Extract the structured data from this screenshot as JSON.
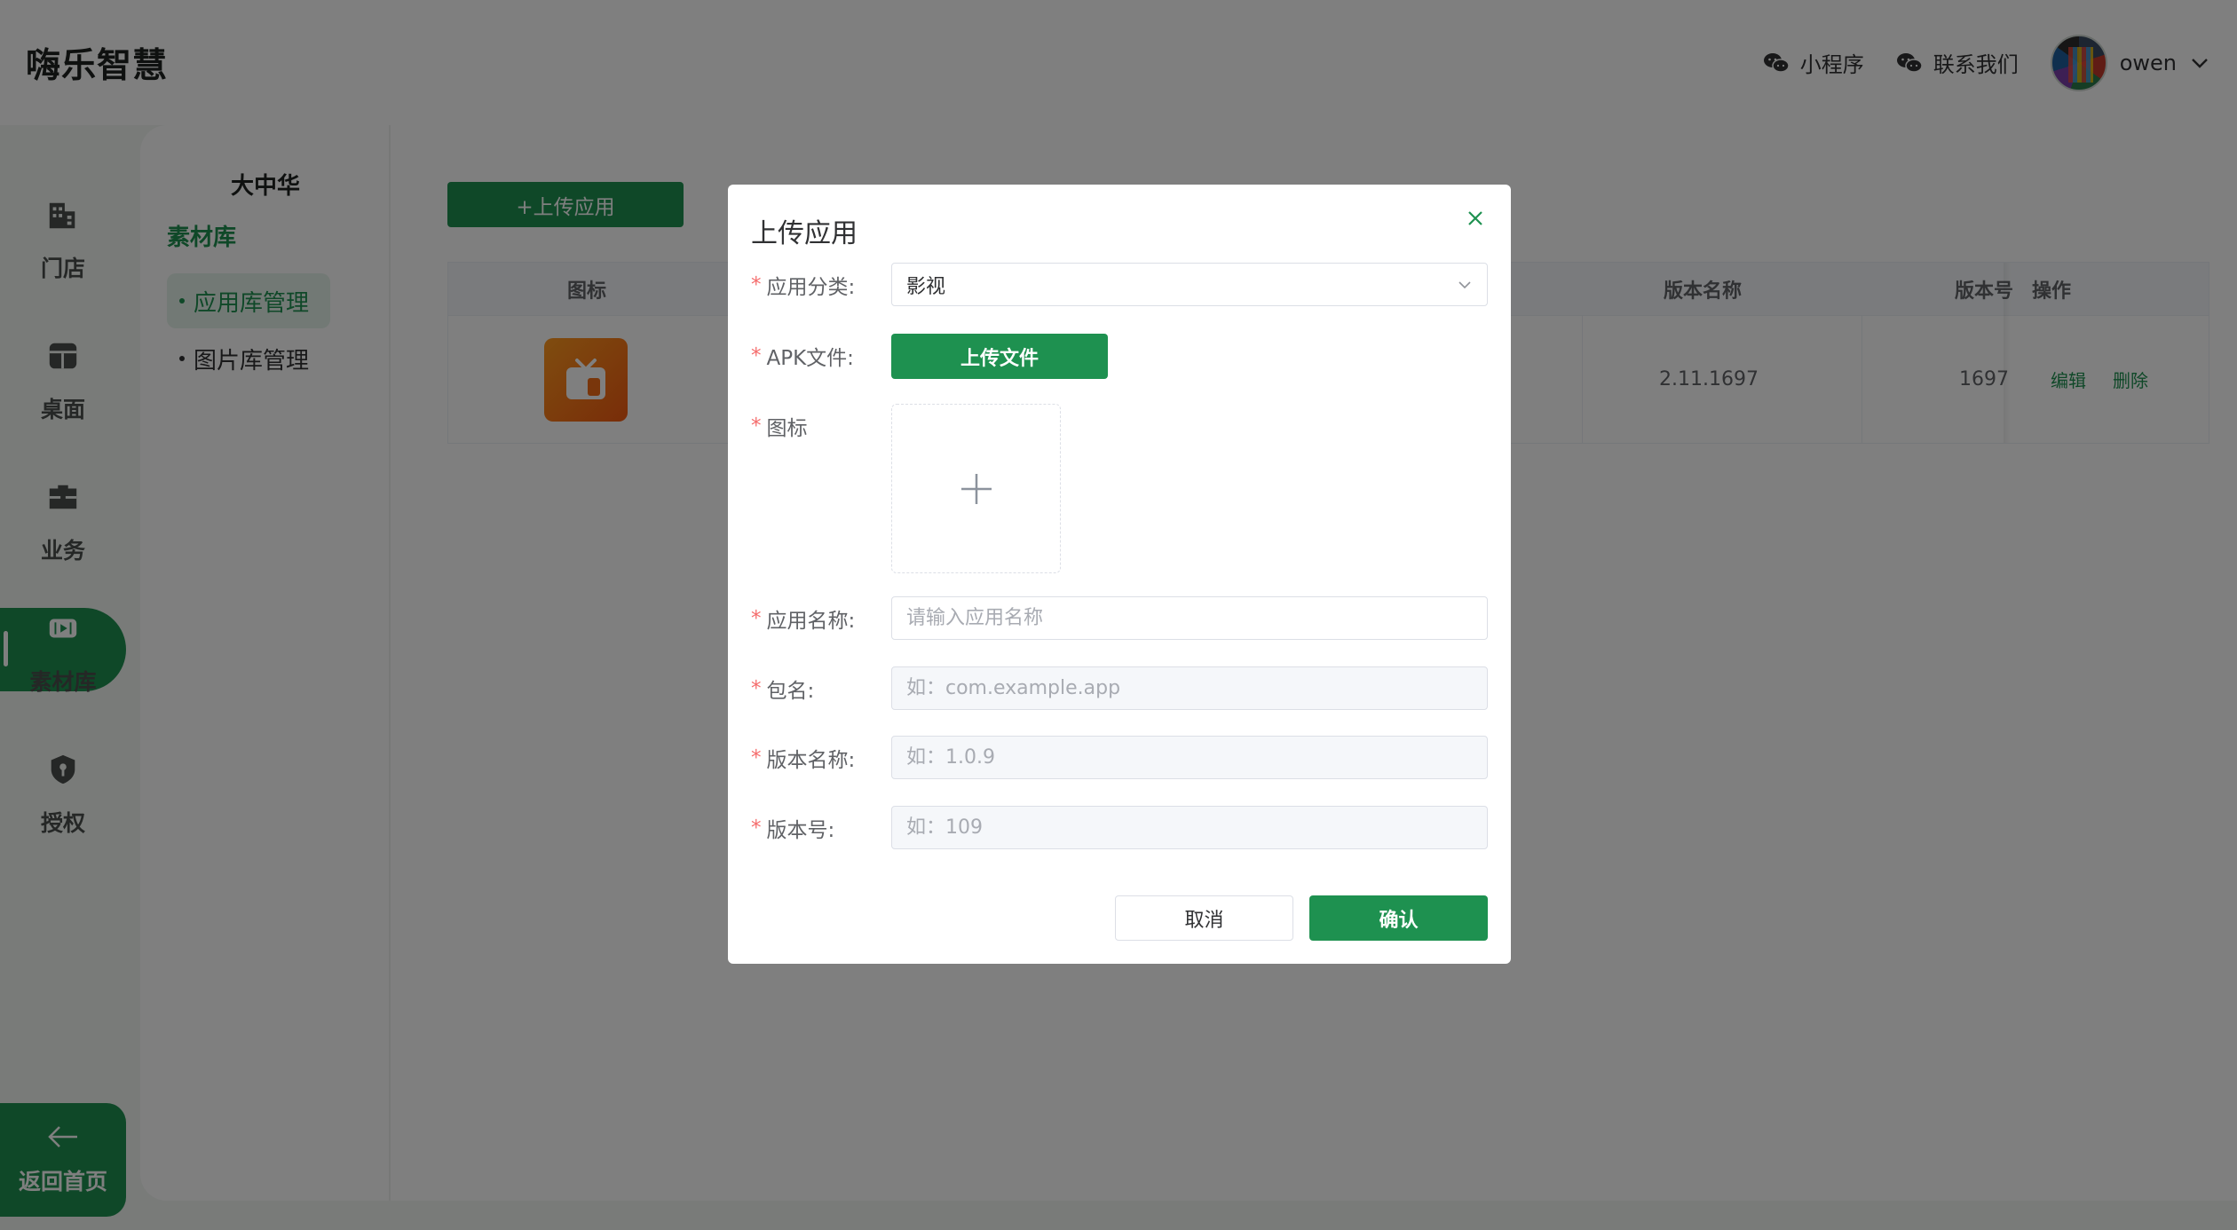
{
  "header": {
    "brand": "嗨乐智慧",
    "mini_program": "小程序",
    "contact_us": "联系我们",
    "username": "owen"
  },
  "leftnav": {
    "items": [
      {
        "label": "门店",
        "icon": "building-icon"
      },
      {
        "label": "桌面",
        "icon": "desktop-icon"
      },
      {
        "label": "业务",
        "icon": "briefcase-icon"
      },
      {
        "label": "素材库",
        "icon": "video-icon"
      },
      {
        "label": "授权",
        "icon": "shield-key-icon"
      }
    ],
    "active_index": 3,
    "back_home": "返回首页"
  },
  "subnav": {
    "store_name": "大中华",
    "section_title": "素材库",
    "items": [
      {
        "label": "应用库管理",
        "active": true
      },
      {
        "label": "图片库管理",
        "active": false
      }
    ]
  },
  "content": {
    "upload_app_button": "+上传应用",
    "table": {
      "headers": {
        "icon": "图标",
        "version_name": "版本名称",
        "version_code": "版本号",
        "actions": "操作"
      },
      "rows": [
        {
          "version_name": "2.11.1697",
          "version_code": "1697",
          "edit": "编辑",
          "delete": "删除"
        }
      ]
    }
  },
  "dialog": {
    "title": "上传应用",
    "fields": {
      "category": {
        "label": "应用分类:",
        "value": "影视"
      },
      "apk": {
        "label": "APK文件:",
        "button": "上传文件"
      },
      "icon": {
        "label": "图标"
      },
      "app_name": {
        "label": "应用名称:",
        "placeholder": "请输入应用名称"
      },
      "package": {
        "label": "包名:",
        "placeholder": "如：com.example.app"
      },
      "version_name": {
        "label": "版本名称:",
        "placeholder": "如：1.0.9"
      },
      "version_code": {
        "label": "版本号:",
        "placeholder": "如：109"
      }
    },
    "cancel": "取消",
    "confirm": "确认"
  },
  "colors": {
    "primary": "#1e9150",
    "required": "#f56c6c"
  }
}
